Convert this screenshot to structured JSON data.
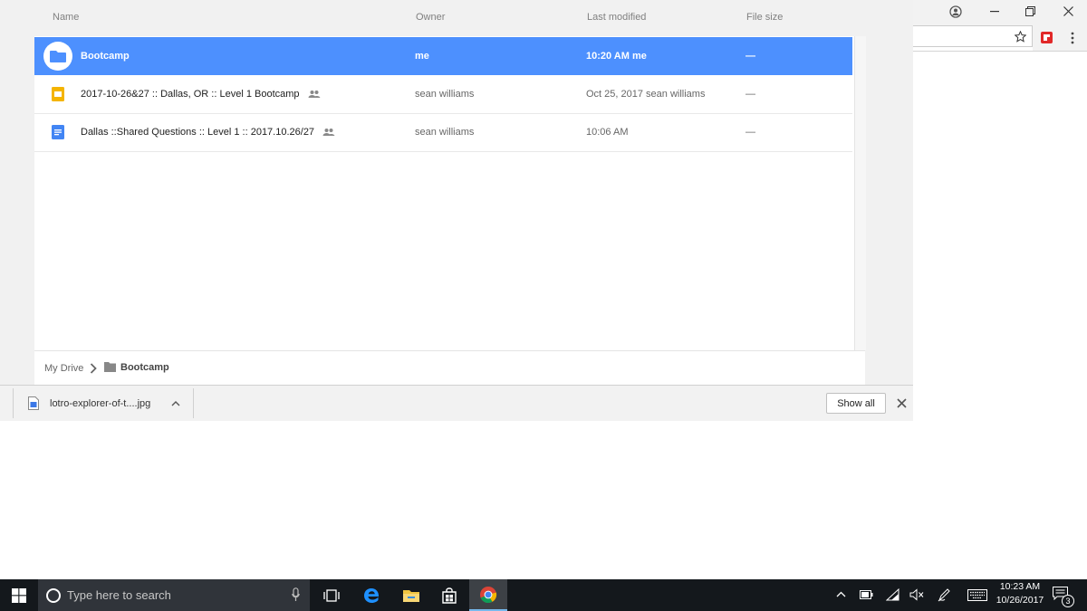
{
  "picker": {
    "columns": {
      "name": "Name",
      "owner": "Owner",
      "modified": "Last modified",
      "size": "File size"
    },
    "rows": [
      {
        "name": "Bootcamp",
        "owner": "me",
        "modified": "10:20 AM  me",
        "size": "—",
        "type": "folder",
        "selected": true,
        "shared": false
      },
      {
        "name": "2017-10-26&27 :: Dallas, OR :: Level 1 Bootcamp",
        "owner": "sean williams",
        "modified": "Oct 25, 2017  sean williams",
        "size": "—",
        "type": "slides",
        "selected": false,
        "shared": true
      },
      {
        "name": "Dallas ::Shared Questions :: Level 1 :: 2017.10.26/27",
        "owner": "sean williams",
        "modified": "10:06 AM",
        "size": "—",
        "type": "docs",
        "selected": false,
        "shared": true
      }
    ],
    "breadcrumb": {
      "root": "My Drive",
      "current": "Bootcamp"
    }
  },
  "downloads": {
    "file_name": "lotro-explorer-of-t....jpg",
    "show_all_label": "Show all"
  },
  "taskbar": {
    "search_placeholder": "Type here to search",
    "time": "10:23 AM",
    "date": "10/26/2017",
    "notification_count": "3"
  },
  "colors": {
    "selected_row": "#4d90fe",
    "slides_icon": "#f4b400",
    "docs_icon": "#4285f4",
    "taskbar_bg": "#14181c"
  }
}
